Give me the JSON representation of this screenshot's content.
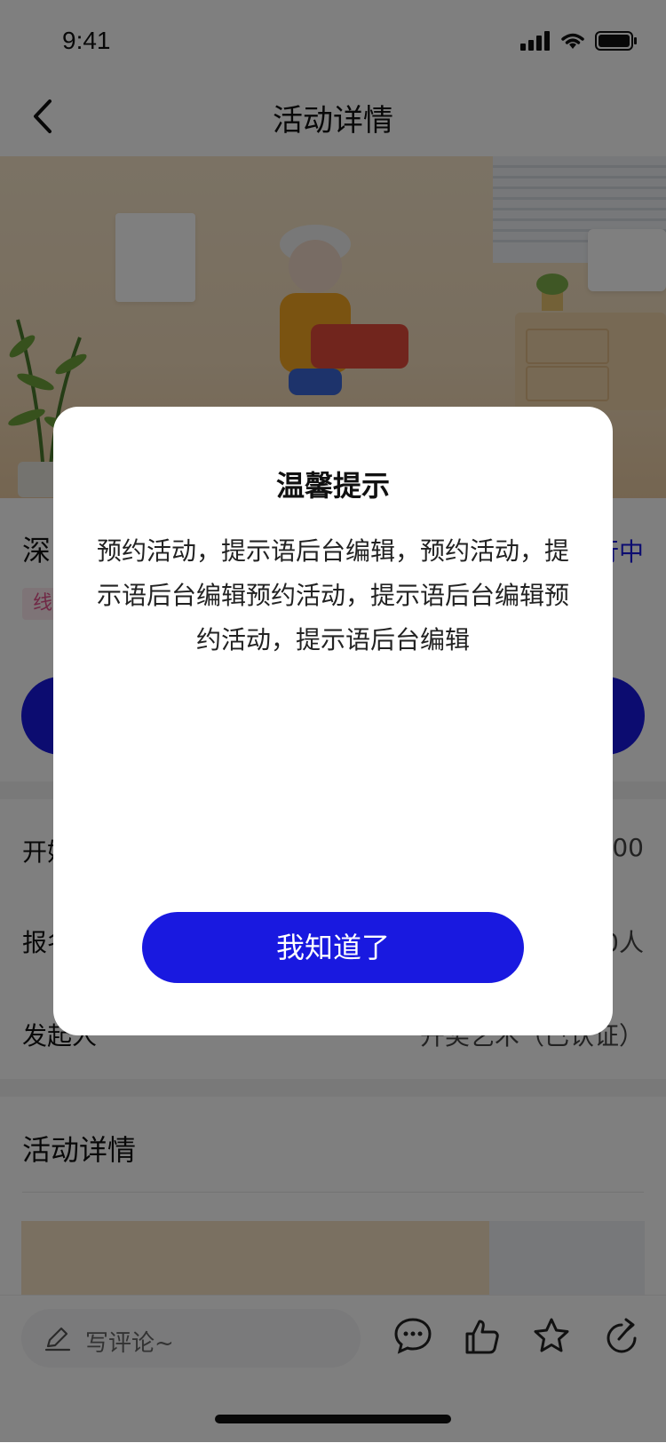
{
  "status_bar": {
    "time": "9:41"
  },
  "nav": {
    "title": "活动详情"
  },
  "content": {
    "title_partial": "深",
    "status_partial": "行中",
    "tag_partial": "线",
    "rows": [
      {
        "label_partial": "开始",
        "value_partial": "00"
      },
      {
        "label_partial": "报名",
        "value_partial": "0人"
      },
      {
        "label": "发起人",
        "value": "开奖艺术（已认证）"
      }
    ],
    "detail_title": "活动详情"
  },
  "bottom_bar": {
    "comment_placeholder": "写评论~",
    "icons": [
      "comment-icon",
      "like-icon",
      "favorite-icon",
      "share-icon"
    ]
  },
  "modal": {
    "title": "温馨提示",
    "body": "预约活动，提示语后台编辑，预约活动，提示语后台编辑预约活动，提示语后台编辑预约活动，提示语后台编辑",
    "confirm_label": "我知道了"
  },
  "colors": {
    "accent": "#1919e0",
    "overlay": "rgba(0,0,0,0.5)"
  }
}
